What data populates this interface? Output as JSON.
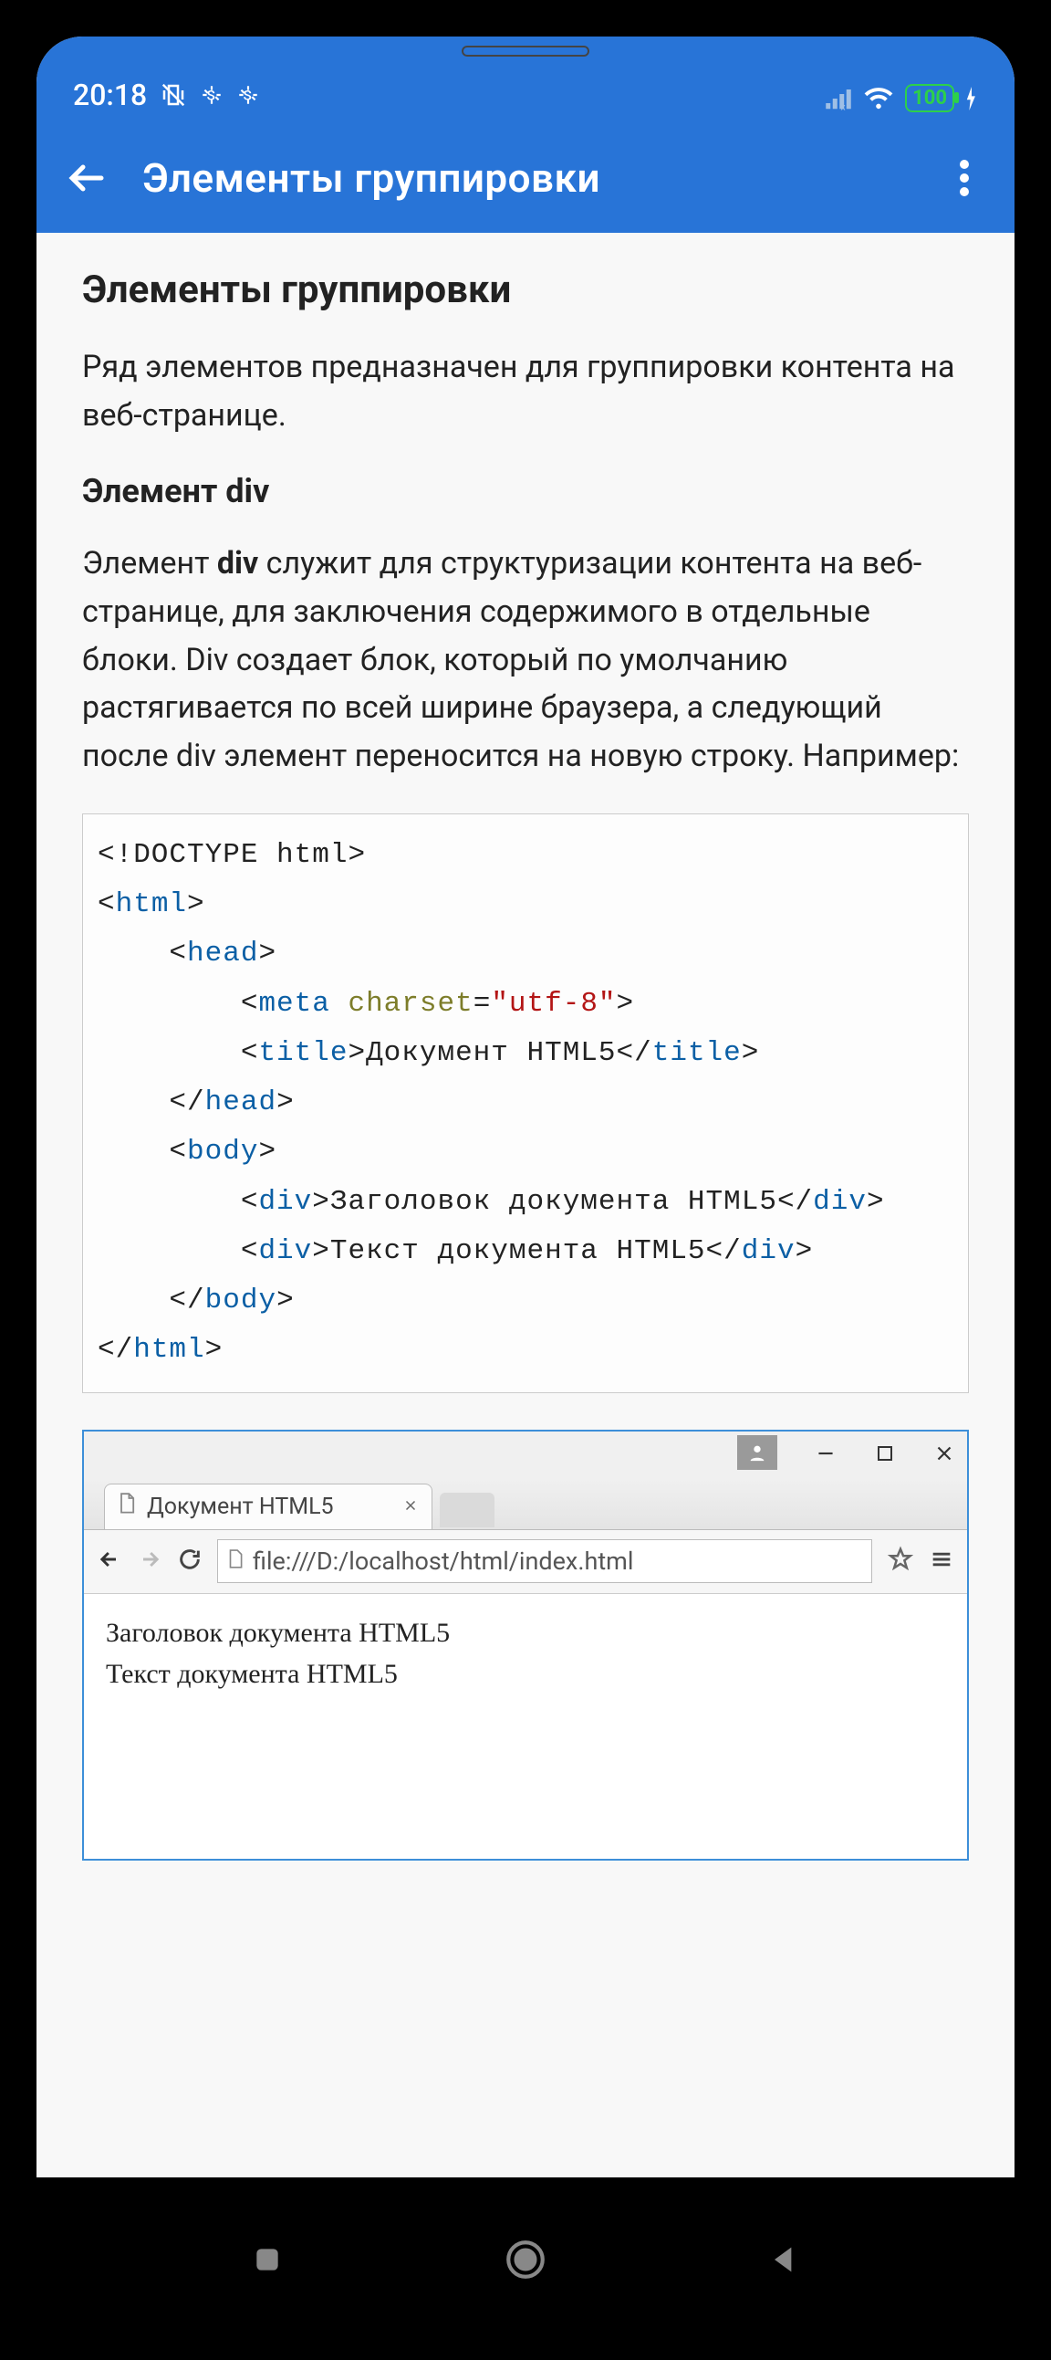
{
  "status": {
    "time": "20:18",
    "battery": "100"
  },
  "appBar": {
    "title": "Элементы группировки"
  },
  "page": {
    "heading": "Элементы группировки",
    "intro": "Ряд элементов предназначен для группировки контента на веб-странице.",
    "subheading": "Элемент div",
    "para2_before": "Элемент ",
    "para2_bold": "div",
    "para2_after": " служит для структуризации контента на веб-странице, для заключения содержимого в отдельные блоки. Div создает блок, который по умолчанию растягивается по всей ширине браузера, а следующий после div элемент переносится на новую строку. Например:"
  },
  "code": {
    "doctype": "<!DOCTYPE html>",
    "html_open": "html",
    "head_open": "head",
    "meta_tag": "meta",
    "meta_attr": "charset",
    "meta_val": "\"utf-8\"",
    "title_tag": "title",
    "title_text": "Документ HTML5",
    "head_close": "head",
    "body_tag": "body",
    "div_tag": "div",
    "div1_text": "Заголовок документа HTML5",
    "div2_text": "Текст документа HTML5",
    "html_close": "html"
  },
  "browser": {
    "tabTitle": "Документ HTML5",
    "url": "file:///D:/localhost/html/index.html",
    "line1": "Заголовок документа HTML5",
    "line2": "Текст документа HTML5"
  }
}
